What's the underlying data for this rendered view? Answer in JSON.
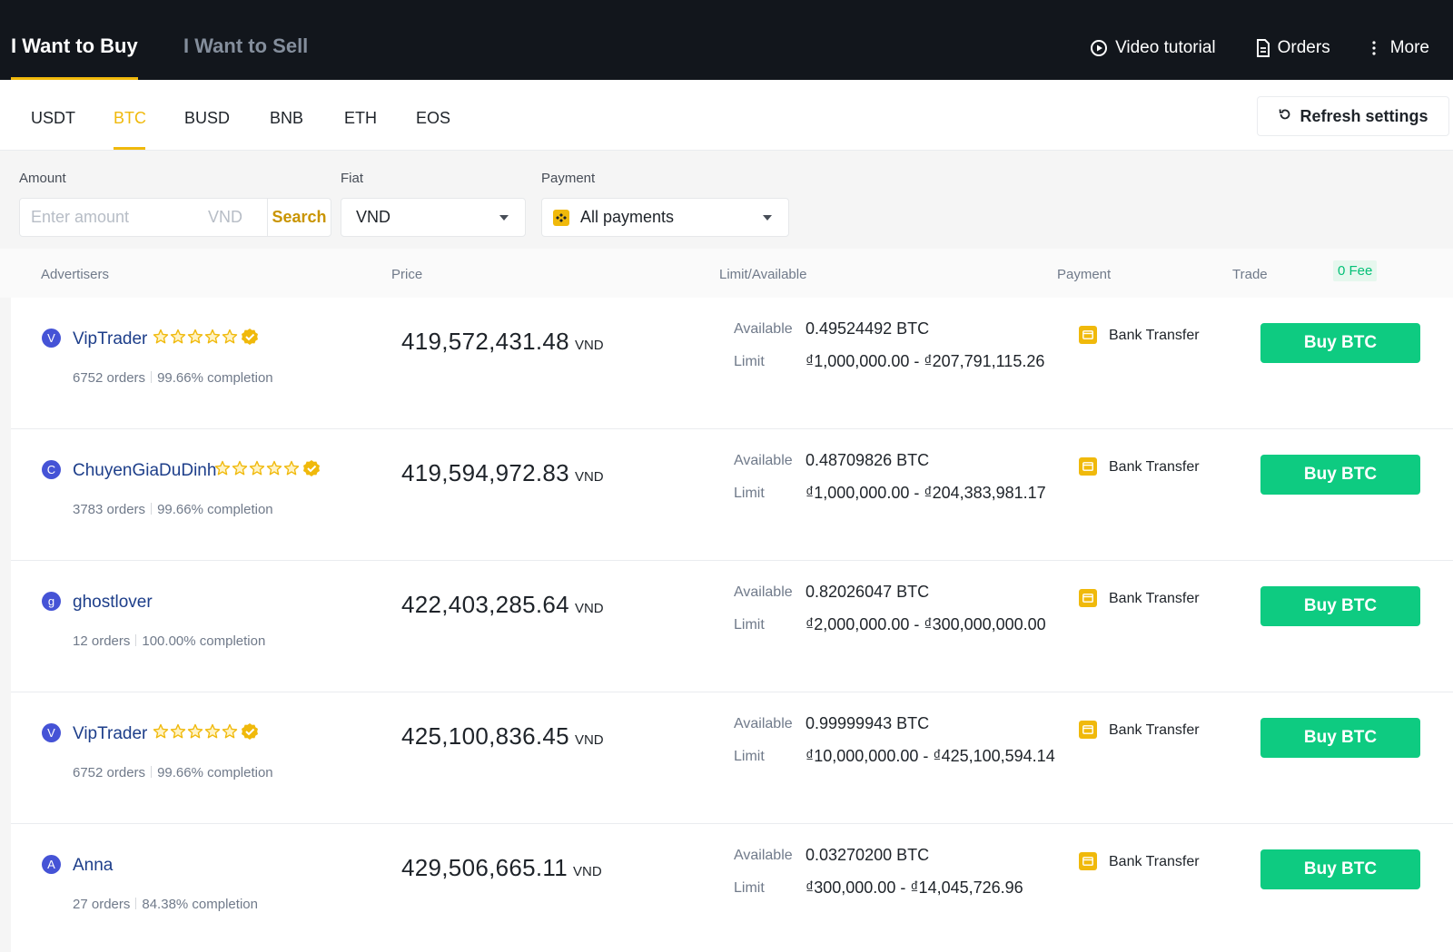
{
  "header": {
    "tabs": [
      {
        "label": "I Want to Buy",
        "active": true
      },
      {
        "label": "I Want to Sell",
        "active": false
      }
    ],
    "actions": {
      "video": "Video tutorial",
      "orders": "Orders",
      "more": "More"
    }
  },
  "coins": {
    "tabs": [
      "USDT",
      "BTC",
      "BUSD",
      "BNB",
      "ETH",
      "EOS"
    ],
    "active": "BTC",
    "refresh_label": "Refresh settings"
  },
  "filters": {
    "amount_label": "Amount",
    "amount_placeholder": "Enter amount",
    "amount_unit": "VND",
    "search_label": "Search",
    "fiat_label": "Fiat",
    "fiat_value": "VND",
    "payment_label": "Payment",
    "payment_value": "All payments"
  },
  "table": {
    "headers": {
      "advertisers": "Advertisers",
      "price": "Price",
      "limit": "Limit/Available",
      "payment": "Payment",
      "trade": "Trade",
      "fee": "0 Fee"
    },
    "available_label": "Available",
    "limit_label": "Limit",
    "price_unit": "VND",
    "rows": [
      {
        "avatar": "V",
        "name": "VipTrader",
        "stars": 5,
        "verified": true,
        "orders": "6752 orders",
        "completion": "99.66% completion",
        "price": "419,572,431.48",
        "available": "0.49524492 BTC",
        "limit": "₫1,000,000.00 - ₫207,791,115.26",
        "payment": "Bank Transfer",
        "button": "Buy BTC"
      },
      {
        "avatar": "C",
        "name": "ChuyenGiaDuDinh",
        "stars": 5,
        "verified": true,
        "orders": "3783 orders",
        "completion": "99.66% completion",
        "price": "419,594,972.83",
        "available": "0.48709826 BTC",
        "limit": "₫1,000,000.00 - ₫204,383,981.17",
        "payment": "Bank Transfer",
        "button": "Buy BTC"
      },
      {
        "avatar": "g",
        "name": "ghostlover",
        "stars": 0,
        "verified": false,
        "orders": "12 orders",
        "completion": "100.00% completion",
        "price": "422,403,285.64",
        "available": "0.82026047 BTC",
        "limit": "₫2,000,000.00 - ₫300,000,000.00",
        "payment": "Bank Transfer",
        "button": "Buy BTC"
      },
      {
        "avatar": "V",
        "name": "VipTrader",
        "stars": 5,
        "verified": true,
        "orders": "6752 orders",
        "completion": "99.66% completion",
        "price": "425,100,836.45",
        "available": "0.99999943 BTC",
        "limit": "₫10,000,000.00 - ₫425,100,594.14",
        "payment": "Bank Transfer",
        "button": "Buy BTC"
      },
      {
        "avatar": "A",
        "name": "Anna",
        "stars": 0,
        "verified": false,
        "orders": "27 orders",
        "completion": "84.38% completion",
        "price": "429,506,665.11",
        "available": "0.03270200 BTC",
        "limit": "₫300,000.00 - ₫14,045,726.96",
        "payment": "Bank Transfer",
        "button": "Buy BTC"
      }
    ]
  },
  "colors": {
    "accent": "#f0b90b",
    "buy": "#0ecb81",
    "header_bg": "#12161c",
    "link": "#1d3e8a"
  }
}
